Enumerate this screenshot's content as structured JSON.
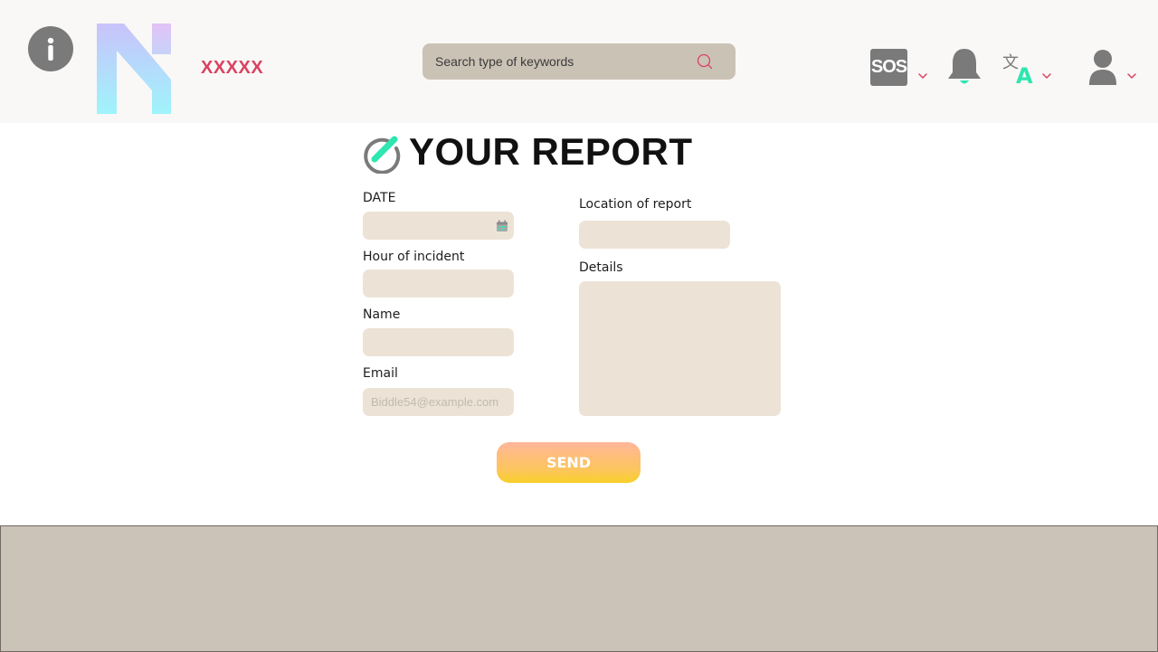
{
  "header": {
    "brand": "XXXXX",
    "search_placeholder": "Search type of keywords",
    "sos_label": "SOS",
    "icons": [
      "info-icon",
      "logo",
      "search-icon",
      "sos-icon",
      "bell-icon",
      "translate-icon",
      "user-icon",
      "chevron-down-icon"
    ]
  },
  "form": {
    "title": "YOUR REPORT",
    "date_label": "DATE",
    "hour_label": "Hour of incident",
    "name_label": "Name",
    "email_label": "Email",
    "email_placeholder": "Biddle54@example.com",
    "location_label": "Location of report",
    "details_label": "Details",
    "send_label": "SEND"
  },
  "colors": {
    "brand_red": "#d94261",
    "accent_teal": "#2ee6b0",
    "field_bg": "#ece3d6",
    "search_bg": "#cbc2b6",
    "footer_bg": "#cbc3b7",
    "icon_gray": "#7a7a7a"
  }
}
